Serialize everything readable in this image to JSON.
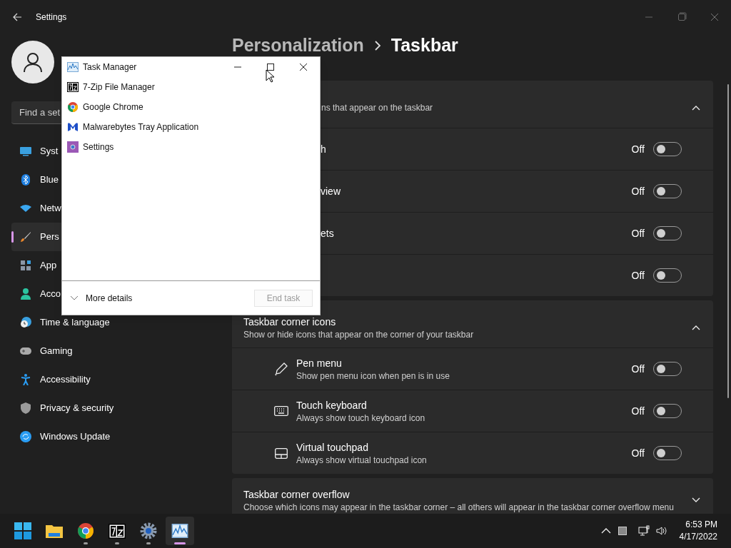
{
  "window": {
    "title": "Settings"
  },
  "sidebar": {
    "search": {
      "placeholder": "Find a set"
    },
    "items": [
      {
        "label": "Syst",
        "selected": false
      },
      {
        "label": "Blue",
        "selected": false
      },
      {
        "label": "Netw",
        "selected": false
      },
      {
        "label": "Pers",
        "selected": true
      },
      {
        "label": "App",
        "selected": false
      },
      {
        "label": "Acco",
        "selected": false
      },
      {
        "label": "Time & language",
        "selected": false
      },
      {
        "label": "Gaming",
        "selected": false
      },
      {
        "label": "Accessibility",
        "selected": false
      },
      {
        "label": "Privacy & security",
        "selected": false
      },
      {
        "label": "Windows Update",
        "selected": false
      }
    ]
  },
  "content": {
    "breadcrumb": {
      "parent": "Personalization",
      "current": "Taskbar"
    },
    "sections": [
      {
        "subtitle": "ns that appear on the taskbar",
        "expanded": true,
        "settings": [
          {
            "label": "h",
            "state": "Off",
            "on": false
          },
          {
            "label": "view",
            "state": "Off",
            "on": false
          },
          {
            "label": "ets",
            "state": "Off",
            "on": false
          },
          {
            "state": "Off",
            "on": false
          }
        ]
      },
      {
        "title": "Taskbar corner icons",
        "subtitle": "Show or hide icons that appear on the corner of your taskbar",
        "expanded": true,
        "settings": [
          {
            "label": "Pen menu",
            "description": "Show pen menu icon when pen is in use",
            "state": "Off",
            "on": false
          },
          {
            "label": "Touch keyboard",
            "description": "Always show touch keyboard icon",
            "state": "Off",
            "on": false
          },
          {
            "label": "Virtual touchpad",
            "description": "Always show virtual touchpad icon",
            "state": "Off",
            "on": false
          }
        ]
      },
      {
        "title": "Taskbar corner overflow",
        "subtitle": "Choose which icons may appear in the taskbar corner – all others will appear in the taskbar corner overflow menu",
        "expanded": false
      }
    ]
  },
  "task_manager": {
    "title": "Task Manager",
    "apps": [
      "7-Zip File Manager",
      "Google Chrome",
      "Malwarebytes Tray Application",
      "Settings"
    ],
    "more_details": "More details",
    "end_task": {
      "label": "End task",
      "disabled": true
    }
  },
  "taskbar": {
    "apps": [
      {
        "running": false,
        "selected": false
      },
      {
        "running": false,
        "selected": false
      },
      {
        "running": true,
        "selected": false
      },
      {
        "running": true,
        "selected": false
      },
      {
        "running": true,
        "selected": false
      },
      {
        "running": true,
        "selected": true
      }
    ],
    "time": "6:53 PM",
    "date": "4/17/2022"
  }
}
